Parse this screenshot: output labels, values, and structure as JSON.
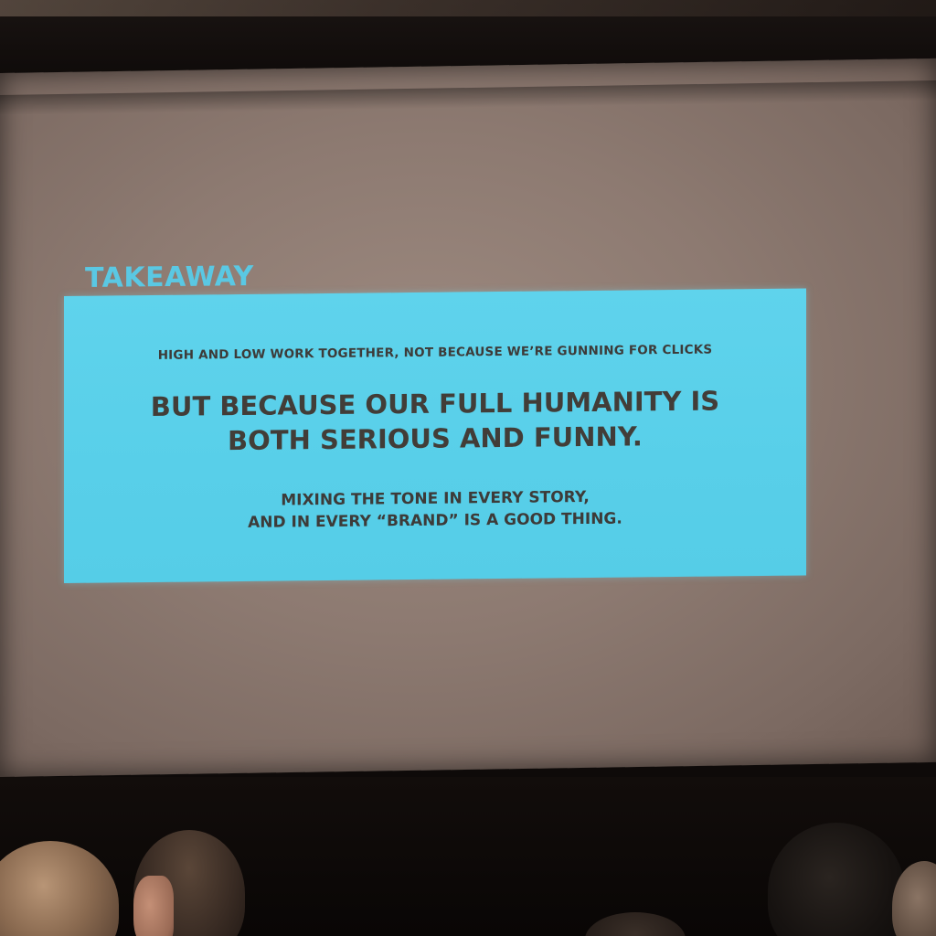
{
  "slide": {
    "heading": "TAKEAWAY",
    "line_small": "HIGH AND LOW WORK TOGETHER, NOT BECAUSE WE’RE GUNNING FOR CLICKS",
    "line_big": [
      "BUT BECAUSE OUR FULL HUMANITY IS",
      "BOTH SERIOUS AND FUNNY."
    ],
    "line_mid": [
      "MIXING THE TONE IN EVERY STORY,",
      "AND IN EVERY “BRAND” IS A GOOD THING."
    ]
  },
  "colors": {
    "accent_cyan": "#5ac8e3",
    "box_fill": "#58cfe9",
    "text_dark": "#3d3b39",
    "screen": "#8d7a71"
  }
}
